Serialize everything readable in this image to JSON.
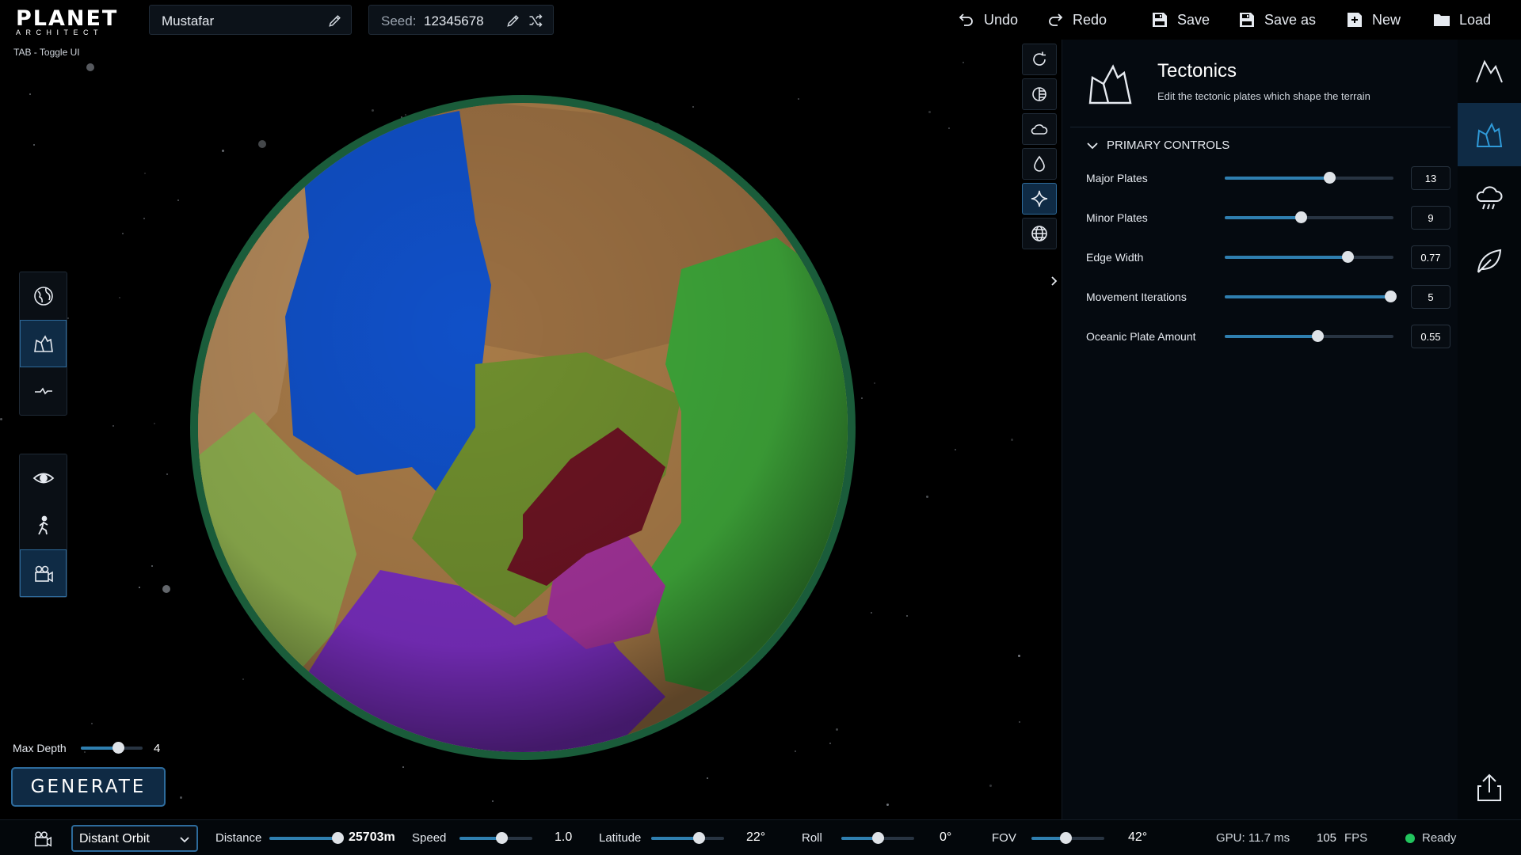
{
  "app": {
    "logo_main": "PLANET",
    "logo_sub": "ARCHITECT",
    "toggle_hint": "TAB - Toggle UI"
  },
  "topbar": {
    "planet_name": "Mustafar",
    "seed_label": "Seed:",
    "seed_value": "12345678",
    "undo": "Undo",
    "redo": "Redo",
    "save": "Save",
    "save_as": "Save as",
    "new": "New",
    "load": "Load"
  },
  "left_tools": {
    "top": [
      "globe-icon",
      "tectonics-icon",
      "flatten-icon"
    ],
    "top_active": 1,
    "bottom": [
      "eye-icon",
      "walk-icon",
      "camera-icon"
    ],
    "bottom_active": 2
  },
  "max_depth": {
    "label": "Max Depth",
    "value": "4",
    "fraction": 0.6
  },
  "generate_label": "GENERATE",
  "view_toggles": [
    "rotate-icon",
    "shading-icon",
    "cloud-icon",
    "water-icon",
    "sparkle-icon",
    "grid-globe-icon"
  ],
  "view_active": 4,
  "panel": {
    "title": "Tectonics",
    "subtitle": "Edit the tectonic plates which shape the terrain",
    "section": "PRIMARY CONTROLS",
    "params": [
      {
        "label": "Major Plates",
        "value": "13",
        "fraction": 0.62
      },
      {
        "label": "Minor Plates",
        "value": "9",
        "fraction": 0.45
      },
      {
        "label": "Edge Width",
        "value": "0.77",
        "fraction": 0.73
      },
      {
        "label": "Movement Iterations",
        "value": "5",
        "fraction": 0.98
      },
      {
        "label": "Oceanic Plate Amount",
        "value": "0.55",
        "fraction": 0.55
      }
    ]
  },
  "right_sidebar": [
    "mountain-icon",
    "tectonics-icon",
    "rain-cloud-icon",
    "leaf-icon",
    "export-icon"
  ],
  "right_active": 1,
  "bottombar": {
    "camera_mode": "Distant Orbit",
    "distance_label": "Distance",
    "distance_value": "25703m",
    "distance_fraction": 0.95,
    "speed_label": "Speed",
    "speed_value": "1.0",
    "speed_fraction": 0.58,
    "latitude_label": "Latitude",
    "latitude_value": "22°",
    "latitude_fraction": 0.65,
    "roll_label": "Roll",
    "roll_value": "0°",
    "roll_fraction": 0.5,
    "fov_label": "FOV",
    "fov_value": "42°",
    "fov_fraction": 0.47,
    "gpu": "GPU: 11.7 ms",
    "fps_value": "105",
    "fps_label": "FPS",
    "status": "Ready"
  },
  "colors": {
    "accent": "#2f7fb0",
    "active_bg": "#0f2b45",
    "status_ready": "#22c55e"
  }
}
